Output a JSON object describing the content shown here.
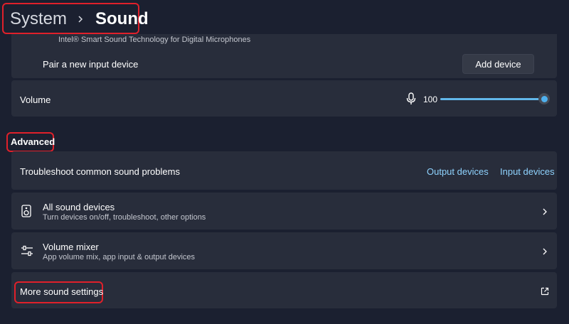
{
  "header": {
    "breadcrumb_parent": "System",
    "breadcrumb_current": "Sound"
  },
  "input_section": {
    "device_subtitle": "Intel® Smart Sound Technology for Digital Microphones",
    "pair_label": "Pair a new input device",
    "add_device_label": "Add device",
    "volume_label": "Volume",
    "volume_value": "100",
    "volume_level": 1.0
  },
  "advanced": {
    "heading": "Advanced",
    "troubleshoot_label": "Troubleshoot common sound problems",
    "output_devices_link": "Output devices",
    "input_devices_link": "Input devices",
    "all_sound_devices": {
      "title": "All sound devices",
      "subtitle": "Turn devices on/off, troubleshoot, other options"
    },
    "volume_mixer": {
      "title": "Volume mixer",
      "subtitle": "App volume mix, app input & output devices"
    },
    "more_sound_settings": "More sound settings"
  },
  "colors": {
    "background": "#1b2030",
    "card": "#282d3b",
    "accent": "#4fb0ee",
    "link": "#8fd3ff",
    "highlight": "#e0202a"
  },
  "icons": {
    "breadcrumb_separator": "chevron-right-icon",
    "volume": "microphone-icon",
    "all_sound_devices": "speaker-icon",
    "volume_mixer": "mixer-sliders-icon",
    "row_arrow": "chevron-right-icon",
    "external": "open-external-icon"
  }
}
